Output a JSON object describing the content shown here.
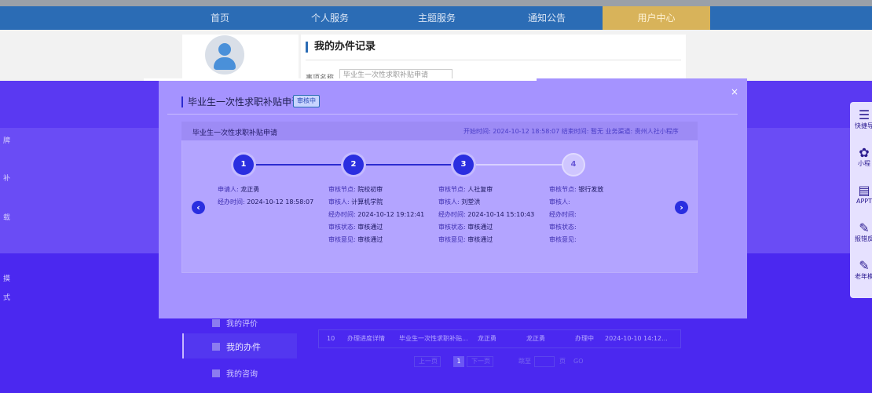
{
  "topnav": {
    "items": [
      "首页",
      "个人服务",
      "主题服务",
      "通知公告",
      "用户中心"
    ]
  },
  "background": {
    "section_title": "我的办件记录",
    "filter_label": "事项名称",
    "filter_value": "毕业生一次性求职补贴申请"
  },
  "modal": {
    "title": "毕业生一次性求职补贴申请",
    "status_badge": "审核中",
    "close_symbol": "×",
    "panel": {
      "name": "毕业生一次性求职补贴申请",
      "meta": "开始时间: 2024-10-12 18:58:07   结束时间: 暂无   业务渠道: 贵州人社小程序"
    },
    "steps": [
      {
        "number": "1",
        "rows": [
          {
            "k": "申请人:",
            "v": "龙正勇"
          },
          {
            "k": "经办时间:",
            "v": "2024-10-12 18:58:07"
          }
        ]
      },
      {
        "number": "2",
        "rows": [
          {
            "k": "审核节点:",
            "v": "院校初审"
          },
          {
            "k": "审核人:",
            "v": "计算机学院"
          },
          {
            "k": "经办时间:",
            "v": "2024-10-12 19:12:41"
          },
          {
            "k": "审核状态:",
            "v": "审核通过"
          },
          {
            "k": "审核意见:",
            "v": "审核通过"
          }
        ]
      },
      {
        "number": "3",
        "rows": [
          {
            "k": "审核节点:",
            "v": "人社复审"
          },
          {
            "k": "审核人:",
            "v": "刘堂洪"
          },
          {
            "k": "经办时间:",
            "v": "2024-10-14 15:10:43"
          },
          {
            "k": "审核状态:",
            "v": "审核通过"
          },
          {
            "k": "审核意见:",
            "v": "审核通过"
          }
        ]
      },
      {
        "number": "4",
        "rows": [
          {
            "k": "审核节点:",
            "v": "银行发放"
          },
          {
            "k": "审核人:",
            "v": ""
          },
          {
            "k": "经办时间:",
            "v": ""
          },
          {
            "k": "审核状态:",
            "v": ""
          },
          {
            "k": "审核意见:",
            "v": ""
          }
        ]
      }
    ],
    "prev_symbol": "‹",
    "next_symbol": "›"
  },
  "right_toolbar": [
    {
      "icon": "☰",
      "icon_name": "menu-icon",
      "label": "快捷导"
    },
    {
      "icon": "✿",
      "icon_name": "miniprogram-icon",
      "label": "小程"
    },
    {
      "icon": "▤",
      "icon_name": "app-icon",
      "label": "APPT"
    },
    {
      "icon": "✎",
      "icon_name": "report-icon",
      "label": "报错反"
    },
    {
      "icon": "✎",
      "icon_name": "elderly-icon",
      "label": "老年模"
    }
  ],
  "left_edge": [
    "牌",
    "补",
    "载",
    "摸",
    "式"
  ],
  "side_menu": [
    {
      "label": "我的评价"
    },
    {
      "label": "我的办件"
    },
    {
      "label": "我的咨询"
    }
  ],
  "record_row": {
    "index": "10",
    "action": "办理进度详情",
    "item": "毕业生一次性求职补贴...",
    "applicant": "龙正勇",
    "handler": "龙正勇",
    "status": "办理中",
    "time": "2024-10-10 14:12..."
  },
  "pager": {
    "prev": "上一页",
    "current": "1",
    "next": "下一页",
    "goto_label": "跳至",
    "page_unit": "页",
    "go": "GO"
  }
}
